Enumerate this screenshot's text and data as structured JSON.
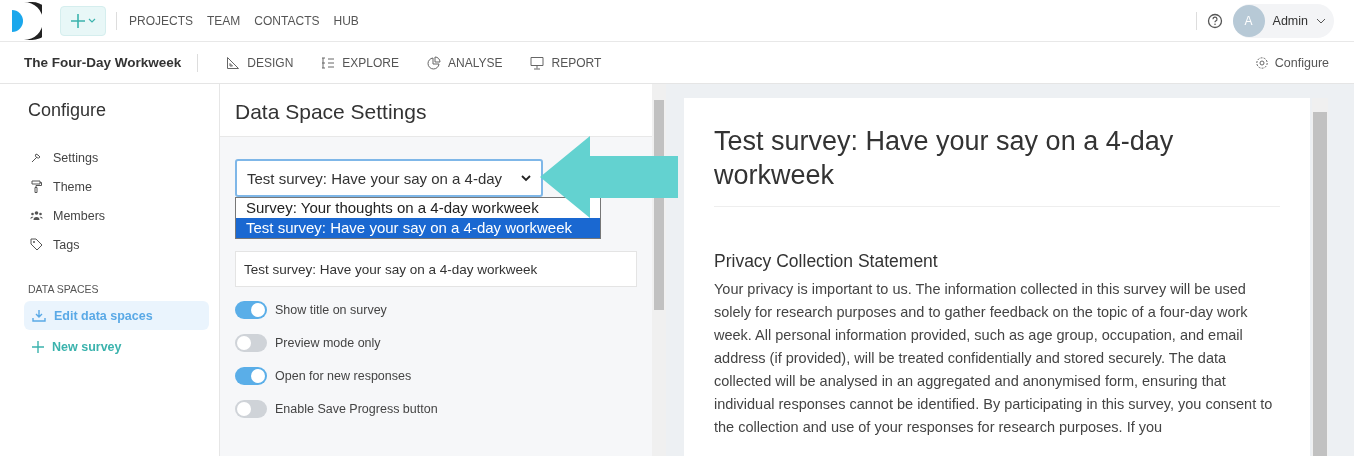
{
  "top_nav": {
    "items": [
      "PROJECTS",
      "TEAM",
      "CONTACTS",
      "HUB"
    ],
    "user": {
      "initial": "A",
      "name": "Admin"
    }
  },
  "project_bar": {
    "title": "The Four-Day Workweek",
    "tabs": [
      {
        "label": "DESIGN"
      },
      {
        "label": "EXPLORE"
      },
      {
        "label": "ANALYSE"
      },
      {
        "label": "REPORT"
      }
    ],
    "configure": "Configure"
  },
  "sidebar": {
    "title": "Configure",
    "items": [
      {
        "label": "Settings"
      },
      {
        "label": "Theme"
      },
      {
        "label": "Members"
      },
      {
        "label": "Tags"
      }
    ],
    "section": "DATA SPACES",
    "links": [
      {
        "label": "Edit data spaces",
        "kind": "active"
      },
      {
        "label": "New survey",
        "kind": "add"
      }
    ]
  },
  "settings": {
    "title": "Data Space Settings",
    "select": {
      "value": "Test survey: Have your say on a 4-day",
      "options": [
        {
          "label": "Survey: Your thoughts on a 4-day workweek",
          "selected": false
        },
        {
          "label": "Test survey: Have your say on a 4-day workweek",
          "selected": true
        }
      ]
    },
    "name_value": "Test survey: Have your say on a 4-day workweek",
    "toggles": [
      {
        "label": "Show title on survey",
        "on": true
      },
      {
        "label": "Preview mode only",
        "on": false
      },
      {
        "label": "Open for new responses",
        "on": true
      },
      {
        "label": "Enable Save Progress button",
        "on": false
      }
    ]
  },
  "preview": {
    "title": "Test survey: Have your say on a 4-day workweek",
    "heading": "Privacy Collection Statement",
    "paragraph": "Your privacy is important to us. The information collected in this survey will be used solely for research purposes and to gather feedback on the topic of a four-day work week. All personal information provided, such as age group, occupation, and email address (if provided), will be treated confidentially and stored securely. The data collected will be analysed in an aggregated and anonymised form, ensuring that individual responses cannot be identified. By participating in this survey, you consent to the collection and use of your responses for research purposes. If you"
  }
}
